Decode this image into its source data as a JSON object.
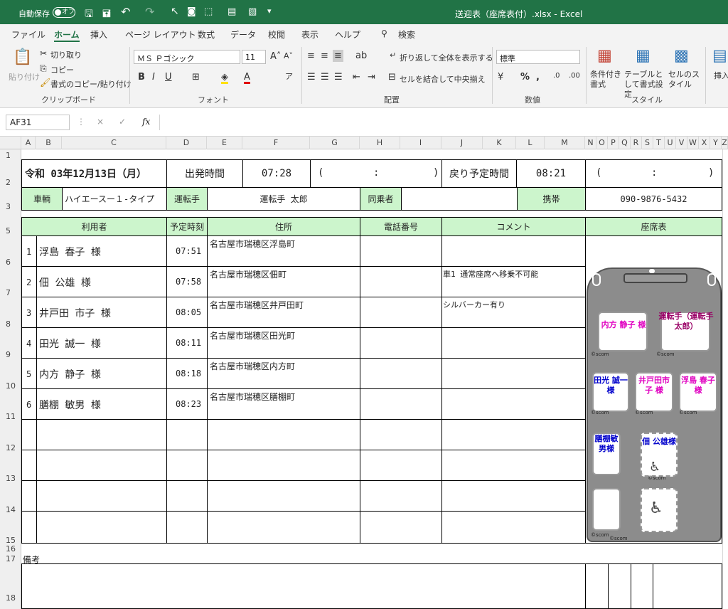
{
  "titlebar": {
    "autosave": "自動保存",
    "toggle": "オフ",
    "title": "送迎表（座席表付）.xlsx - Excel"
  },
  "tabs": [
    "ファイル",
    "ホーム",
    "挿入",
    "ページ レイアウト",
    "数式",
    "データ",
    "校閲",
    "表示",
    "ヘルプ",
    "検索"
  ],
  "ribbon": {
    "clipboard": {
      "paste": "貼り付け",
      "cut": "切り取り",
      "copy": "コピー",
      "format_painter": "書式のコピー/貼り付け",
      "label": "クリップボード"
    },
    "font": {
      "name": "ＭＳ Ｐゴシック",
      "size": "11",
      "label": "フォント"
    },
    "alignment": {
      "wrap": "折り返して全体を表示する",
      "merge": "セルを結合して中央揃え",
      "label": "配置"
    },
    "number": {
      "format": "標準",
      "label": "数値"
    },
    "styles": {
      "conditional": "条件付き書式",
      "table": "テーブルとして書式設定",
      "cell": "セルのスタイル",
      "label": "スタイル"
    },
    "insert": "挿入"
  },
  "formula_bar": {
    "name_box": "AF31",
    "fx": "fx",
    "cancel": "×",
    "enter": "✓"
  },
  "columns": [
    "A",
    "B",
    "C",
    "D",
    "E",
    "F",
    "G",
    "H",
    "I",
    "J",
    "K",
    "L",
    "M",
    "N",
    "O",
    "P",
    "Q",
    "R",
    "S",
    "T",
    "U",
    "V",
    "W",
    "X",
    "Y",
    "Z"
  ],
  "rows": [
    "1",
    "2",
    "3",
    "4",
    "5",
    "6",
    "7",
    "8",
    "9",
    "10",
    "11",
    "12",
    "13",
    "14",
    "15",
    "16",
    "17",
    "18"
  ],
  "sheet": {
    "date": "令和 03年12月13日（月）",
    "depart_label": "出発時間",
    "depart_time": "07:28",
    "paren_open": "(",
    "paren_colon": ":",
    "paren_close": ")",
    "return_label": "戻り予定時間",
    "return_time": "08:21",
    "vehicle_label": "車輌",
    "vehicle": "ハイエースー１-タイプ",
    "driver_label": "運転手",
    "driver": "運転手 太郎",
    "passenger_label": "同乗者",
    "passenger": "",
    "mobile_label": "携帯",
    "mobile": "090-9876-5432",
    "headers": {
      "user": "利用者",
      "time": "予定時刻",
      "address": "住所",
      "phone": "電話番号",
      "comment": "コメント",
      "seating": "座席表"
    },
    "people": [
      {
        "no": "1",
        "name": "浮島 春子 様",
        "time": "07:51",
        "address": "名古屋市瑞穂区浮島町",
        "comment": ""
      },
      {
        "no": "2",
        "name": "佃 公雄 様",
        "time": "07:58",
        "address": "名古屋市瑞穂区佃町",
        "comment": "車1 通常座席へ移乗不可能"
      },
      {
        "no": "3",
        "name": "井戸田 市子 様",
        "time": "08:05",
        "address": "名古屋市瑞穂区井戸田町",
        "comment": "シルバーカー有り"
      },
      {
        "no": "4",
        "name": "田光 誠一 様",
        "time": "08:11",
        "address": "名古屋市瑞穂区田光町",
        "comment": ""
      },
      {
        "no": "5",
        "name": "内方 静子 様",
        "time": "08:18",
        "address": "名古屋市瑞穂区内方町",
        "comment": ""
      },
      {
        "no": "6",
        "name": "膳棚 敏男 様",
        "time": "08:23",
        "address": "名古屋市瑞穂区膳棚町",
        "comment": ""
      }
    ],
    "remarks_label": "備考",
    "seats": {
      "s1": "内方 静子 様",
      "driver": "運転手（運転手 太郎）",
      "s3": "田光 誠一様",
      "s4": "井戸田市子 様",
      "s5": "浮島 春子 様",
      "s6": "膳棚敏男様",
      "s7": "佃 公雄様",
      "scom": "©scom",
      "colors": {
        "magenta": "#e000c0",
        "blue": "#0000cc",
        "dark_magenta": "#990066"
      }
    }
  }
}
